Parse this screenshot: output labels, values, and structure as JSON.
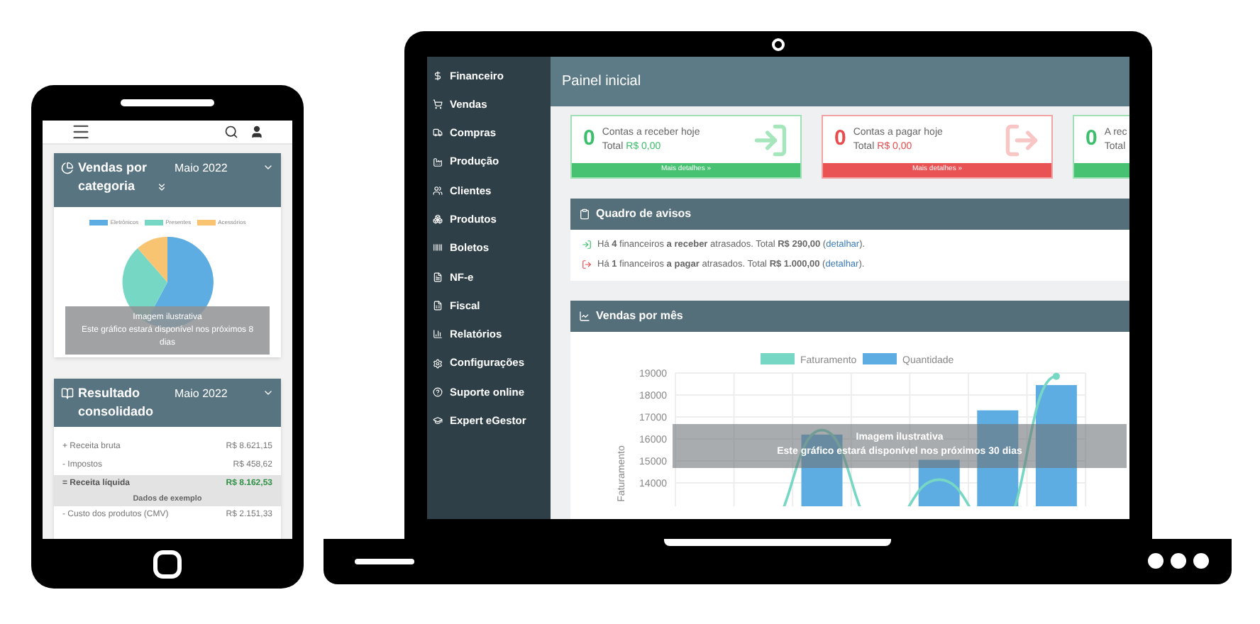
{
  "phone": {
    "category_card": {
      "title": "Vendas por categoria",
      "period": "Maio 2022",
      "legend": [
        {
          "label": "Eletrônicos",
          "color": "#5dade2"
        },
        {
          "label": "Presentes",
          "color": "#76d7c4"
        },
        {
          "label": "Acessórios",
          "color": "#f8c471"
        }
      ],
      "overlay": {
        "title": "Imagem ilustrativa",
        "text": "Este gráfico estará disponível nos próximos 8 dias"
      }
    },
    "result_card": {
      "title": "Resultado consolidado",
      "period": "Maio 2022",
      "rows": [
        {
          "label": "+ Receita bruta",
          "value": "R$ 8.621,15",
          "kind": "line"
        },
        {
          "label": "- Impostos",
          "value": "R$ 458,62",
          "kind": "line"
        },
        {
          "label": "= Receita líquida",
          "value": "R$ 8.162,53",
          "kind": "total"
        },
        {
          "label": "- Custo dos produtos (CMV)",
          "value": "R$ 2.151,33",
          "kind": "line"
        }
      ],
      "overlay": {
        "title": "Dados de exemplo"
      }
    }
  },
  "laptop": {
    "sidebar": {
      "items": [
        {
          "label": "Financeiro"
        },
        {
          "label": "Vendas"
        },
        {
          "label": "Compras"
        },
        {
          "label": "Produção"
        },
        {
          "label": "Clientes"
        },
        {
          "label": "Produtos"
        },
        {
          "label": "Boletos"
        },
        {
          "label": "NF-e"
        },
        {
          "label": "Fiscal"
        },
        {
          "label": "Relatórios"
        },
        {
          "label": "Configurações"
        },
        {
          "label": "Suporte online"
        },
        {
          "label": "Expert eGestor"
        }
      ]
    },
    "page_title": "Painel inicial",
    "summary_cards": [
      {
        "count": "0",
        "title": "Contas a receber hoje",
        "total_label": "Total",
        "total": "R$ 0,00",
        "link": "Mais detalhes »",
        "kind": "in"
      },
      {
        "count": "0",
        "title": "Contas a pagar hoje",
        "total_label": "Total",
        "total": "R$ 0,00",
        "link": "Mais detalhes »",
        "kind": "out"
      },
      {
        "count": "0",
        "title": "A rec",
        "total_label": "Total",
        "kind": "in"
      }
    ],
    "notices": {
      "title": "Quadro de avisos",
      "items": [
        {
          "text": "Há **4** financeiros **a receber** atrasados. Total **R$ 290,00** (",
          "link": "detalhar",
          "end": ").",
          "kind": "in"
        },
        {
          "text": "Há **1** financeiros **a pagar** atrasados. Total **R$ 1.000,00** (",
          "link": "detalhar",
          "end": ").",
          "kind": "out"
        }
      ]
    },
    "sales_panel": {
      "title": "Vendas por mês",
      "overlay": {
        "title": "Imagem ilustrativa",
        "text": "Este gráfico estará disponível nos próximos **30 dias**"
      },
      "chart_data": {
        "type": "bar",
        "ylabel": "Faturamento",
        "ylim": [
          13000,
          19000
        ],
        "yticks": [
          14000,
          15000,
          16000,
          17000,
          18000,
          19000
        ],
        "stacked": false,
        "grid": true,
        "legend": "top",
        "series": [
          {
            "name": "Faturamento",
            "type": "line",
            "color": "#76d7c4",
            "values": [
              null,
              null,
              16400,
              null,
              14150,
              null,
              18850
            ]
          },
          {
            "name": "Quantidade",
            "type": "bar",
            "color": "#5dade2",
            "values": [
              null,
              null,
              16200,
              null,
              15050,
              17300,
              18450
            ]
          }
        ]
      }
    }
  }
}
